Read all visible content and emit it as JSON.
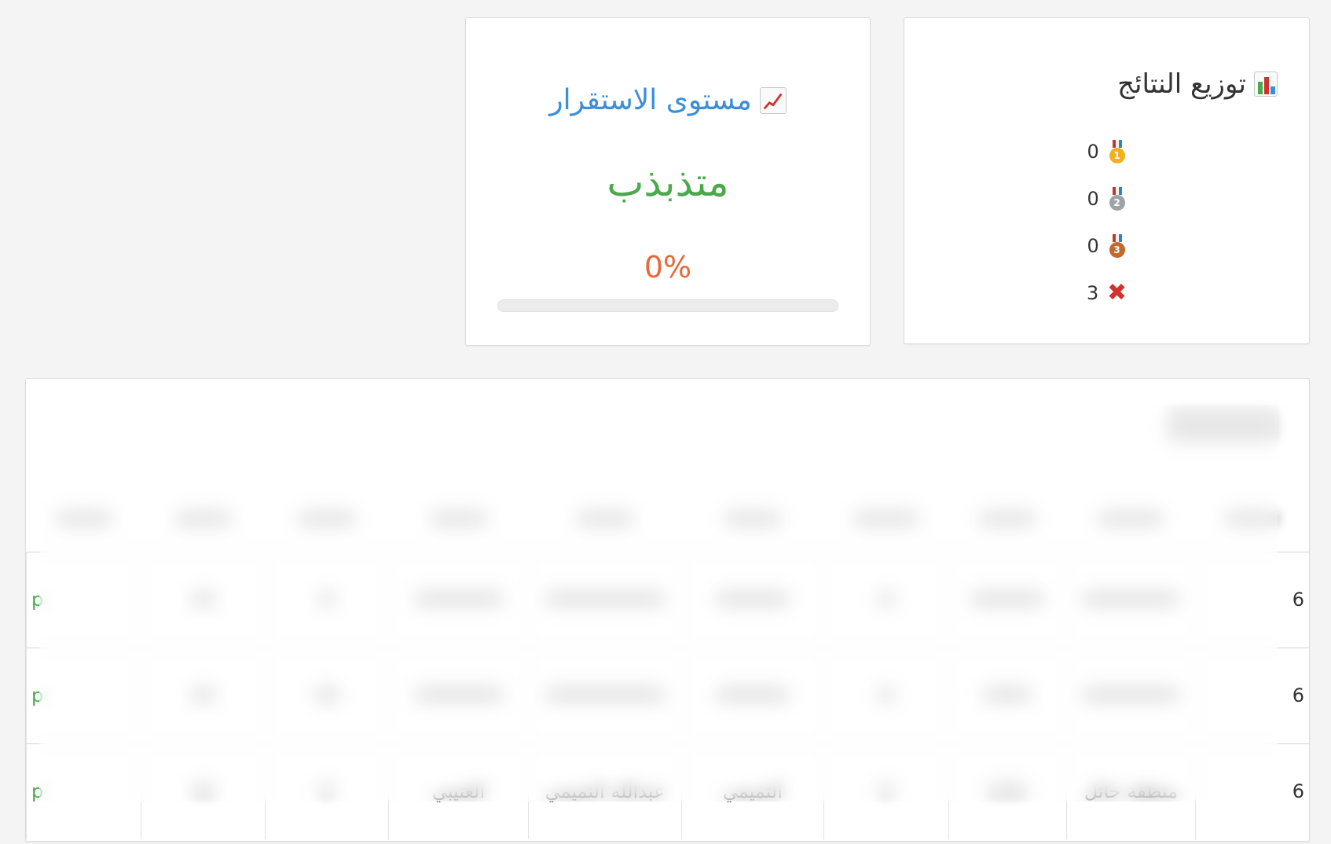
{
  "distribution": {
    "title": "توزيع النتائج",
    "icon": "bar-chart-icon",
    "rows": [
      {
        "icon": "gold-medal-icon",
        "count": "0",
        "color": "#f2b01e",
        "label": "1"
      },
      {
        "icon": "silver-medal-icon",
        "count": "0",
        "color": "#9ea3a8",
        "label": "2"
      },
      {
        "icon": "bronze-medal-icon",
        "count": "0",
        "color": "#c26a2e",
        "label": "3"
      },
      {
        "icon": "cross-icon",
        "count": "3",
        "color": "#d0322e",
        "label": "✖"
      }
    ]
  },
  "stability": {
    "title": "مستوى الاستقرار",
    "icon": "trend-chart-icon",
    "state": "متذبذب",
    "percent_label": "0%",
    "progress": 0,
    "colors": {
      "title": "#3b8fd6",
      "state": "#4aa94d",
      "percent": "#e8683a"
    }
  },
  "table": {
    "rows": [
      {
        "col0": "6",
        "region": "",
        "teacher": "",
        "student": "",
        "status": "p"
      },
      {
        "col0": "6",
        "region": "",
        "teacher": "",
        "student": "",
        "status": "p"
      },
      {
        "col0": "6",
        "region": "منطقة حائل",
        "teacher": "عبدالله التميمي",
        "student_a": "التميمي",
        "student_b": "العتيبي",
        "status": "p"
      }
    ]
  }
}
